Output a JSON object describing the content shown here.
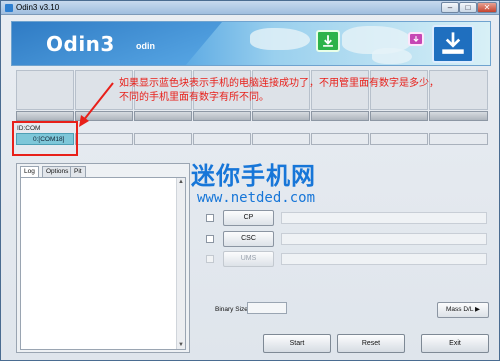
{
  "window": {
    "title": "Odin3 v3.10",
    "min_label": "–",
    "max_label": "□",
    "close_label": "✕"
  },
  "banner": {
    "title": "Odin3",
    "subtitle": "odin",
    "icons": [
      "download-arrow-icon",
      "small-download-icon",
      "device-download-icon"
    ]
  },
  "annotation": {
    "line1": "如果显示蓝色块表示手机的电脑连接成功了，不用管里面有数字是多少，",
    "line2": "不同的手机里面有数字有所不同。",
    "color": "#e8201a"
  },
  "id_com": {
    "label": "ID:COM",
    "port": "0:[COM18]",
    "active_color": "#7ec7d9"
  },
  "tabs": [
    "Log",
    "Options",
    "Pit"
  ],
  "watermark": {
    "cn": "迷你手机网",
    "url": "www.netded.com",
    "color": "#1776d8"
  },
  "files": [
    {
      "label": "CP",
      "enabled": true
    },
    {
      "label": "CSC",
      "enabled": true
    },
    {
      "label": "UMS",
      "enabled": false
    }
  ],
  "binary_size": {
    "label": "Binary Size",
    "value": ""
  },
  "mass_dl": {
    "label": "Mass D/L ▶"
  },
  "actions": {
    "start": "Start",
    "reset": "Reset",
    "exit": "Exit"
  }
}
